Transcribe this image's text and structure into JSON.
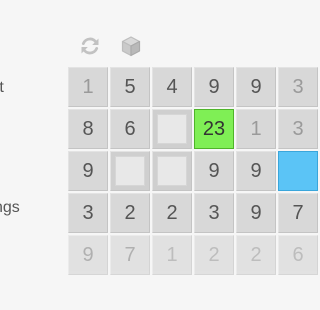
{
  "sidebar": {
    "items": [
      {
        "label": "rt"
      },
      {
        "label": "ngs"
      }
    ]
  },
  "toolbar": {
    "icons": [
      "reload-icon",
      "cube-icon"
    ]
  },
  "colors": {
    "background": "#f6f6f6",
    "cell": "#d8d8d8",
    "selected": "#7fef55",
    "highlight_blue": "#5bc4f6"
  },
  "board": {
    "rows": [
      [
        {
          "value": "1",
          "tone": "light"
        },
        {
          "value": "5",
          "tone": "dark"
        },
        {
          "value": "4",
          "tone": "dark"
        },
        {
          "value": "9",
          "tone": "dark"
        },
        {
          "value": "9",
          "tone": "dark"
        },
        {
          "value": "3",
          "tone": "light"
        }
      ],
      [
        {
          "value": "8",
          "tone": "dark"
        },
        {
          "value": "6",
          "tone": "dark"
        },
        {
          "value": "",
          "state": "empty"
        },
        {
          "value": "23",
          "state": "selected"
        },
        {
          "value": "1",
          "tone": "light"
        },
        {
          "value": "3",
          "tone": "light"
        }
      ],
      [
        {
          "value": "9",
          "tone": "dark"
        },
        {
          "value": "",
          "state": "empty"
        },
        {
          "value": "",
          "state": "empty"
        },
        {
          "value": "9",
          "tone": "dark"
        },
        {
          "value": "9",
          "tone": "dark"
        },
        {
          "value": "",
          "state": "blue"
        }
      ],
      [
        {
          "value": "3",
          "tone": "dark"
        },
        {
          "value": "2",
          "tone": "dark"
        },
        {
          "value": "2",
          "tone": "dark"
        },
        {
          "value": "3",
          "tone": "dark"
        },
        {
          "value": "9",
          "tone": "dark"
        },
        {
          "value": "7",
          "tone": "dark"
        }
      ],
      [
        {
          "value": "9",
          "tone": "dark",
          "faded": true
        },
        {
          "value": "7",
          "tone": "dark",
          "faded": true
        },
        {
          "value": "1",
          "tone": "light",
          "faded": true
        },
        {
          "value": "2",
          "tone": "light",
          "faded": true
        },
        {
          "value": "2",
          "tone": "light",
          "faded": true
        },
        {
          "value": "6",
          "tone": "light",
          "faded": true
        }
      ]
    ]
  }
}
